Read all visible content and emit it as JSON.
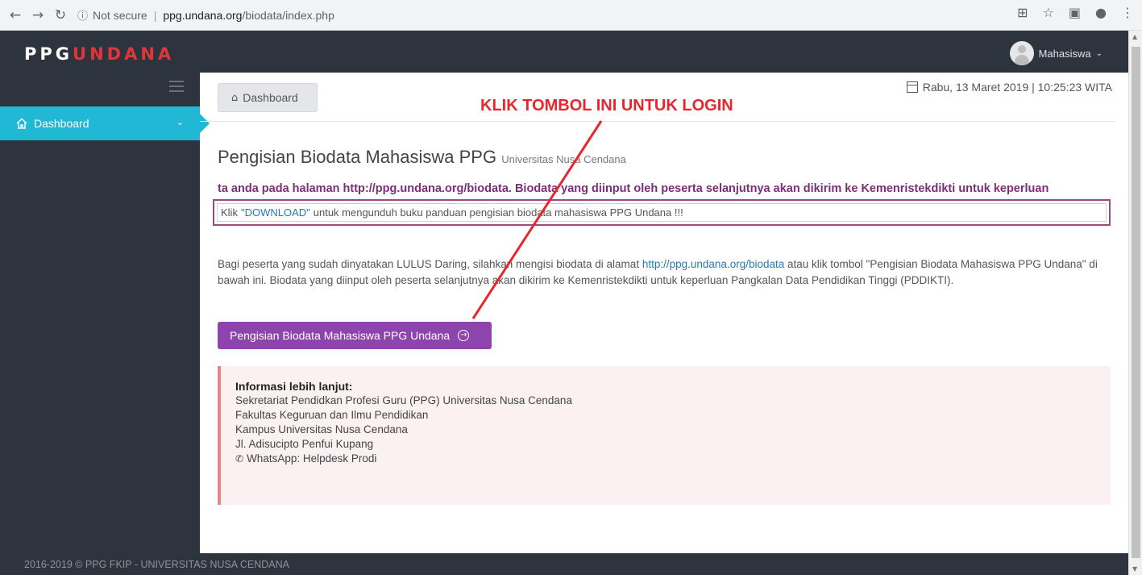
{
  "browser": {
    "security_label": "Not secure",
    "url_host": "ppg.undana.org",
    "url_path": "/biodata/index.php"
  },
  "header": {
    "logo_part1": "PPG",
    "logo_part2": "UNDANA",
    "user_name": "Mahasiswa"
  },
  "sidebar": {
    "items": [
      {
        "label": "Dashboard",
        "icon": "home-icon",
        "active": true
      }
    ]
  },
  "main": {
    "breadcrumb": "Dashboard",
    "datetime": "Rabu, 13 Maret 2019 | 10:25:23 WITA",
    "page_title": "Pengisian Biodata Mahasiswa PPG",
    "page_subtitle": "Universitas Nusa Cendana",
    "marquee": "ta anda pada halaman http://ppg.undana.org/biodata. Biodata yang diinput oleh peserta selanjutnya akan dikirim ke Kemenristekdikti untuk keperluan",
    "notice_prefix": "Klik",
    "notice_link": "\"DOWNLOAD\"",
    "notice_suffix": "untuk mengunduh buku panduan pengisian biodata mahasiswa PPG Undana !!!",
    "desc_part1": "Bagi peserta yang sudah dinyatakan LULUS Daring, silahkan mengisi biodata di alamat",
    "desc_link": "http://ppg.undana.org/biodata",
    "desc_part2": "atau klik tombol \"Pengisian Biodata Mahasiswa PPG Undana\" di bawah ini. Biodata yang diinput oleh peserta selanjutnya akan dikirim ke Kemenristekdikti untuk keperluan Pangkalan Data Pendidikan Tinggi (PDDIKTI).",
    "primary_button": "Pengisian Biodata Mahasiswa PPG Undana",
    "info": {
      "heading": "Informasi lebih lanjut:",
      "lines": [
        "Sekretariat Pendidkan Profesi Guru (PPG) Universitas Nusa Cendana",
        "Fakultas Keguruan dan Ilmu Pendidikan",
        "Kampus Universitas Nusa Cendana",
        "Jl. Adisucipto Penfui Kupang"
      ],
      "whatsapp": "WhatsApp: Helpdesk Prodi"
    }
  },
  "footer": {
    "text": "2016-2019 © PPG FKIP - UNIVERSITAS NUSA CENDANA"
  },
  "annotation": {
    "text": "KLIK TOMBOL INI UNTUK LOGIN",
    "color": "#e8262d"
  },
  "colors": {
    "sidebar_bg": "#2e343d",
    "active_item": "#20b8d4",
    "primary_button": "#8e44ad",
    "logo_accent": "#e0353b"
  }
}
